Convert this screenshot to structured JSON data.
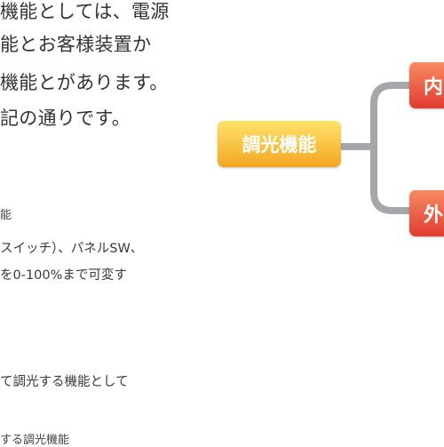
{
  "paragraph": {
    "line1": "機能としては、電源",
    "line2": "能とお客様装置か",
    "line3": "機能とがあります。",
    "line4": "記の通りです。"
  },
  "section1": {
    "heading": "能",
    "line1": "スイッチ）、パネルSW、",
    "line2": "を0-100%まで可変す"
  },
  "section2": {
    "line1": "て調光する機能として",
    "heading": "する調光機能"
  },
  "diagram": {
    "main_label": "調光機能",
    "branch_top_label": "内",
    "branch_bottom_label": "外"
  }
}
